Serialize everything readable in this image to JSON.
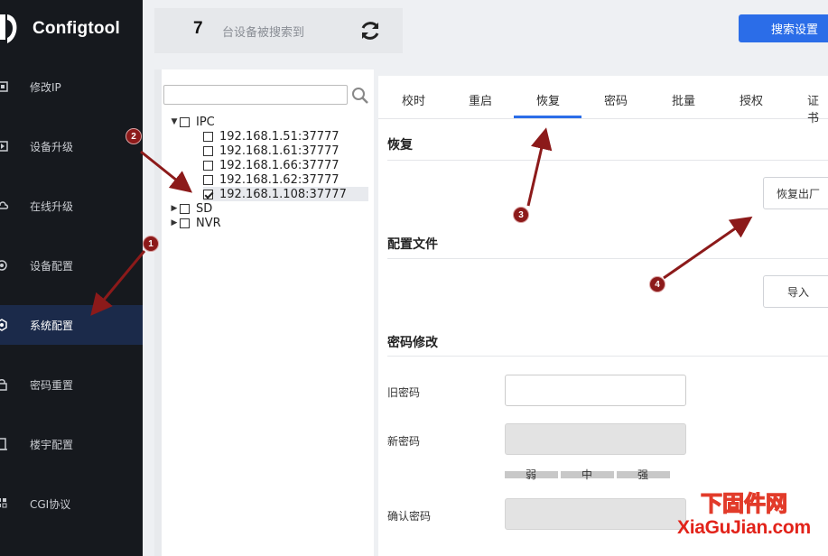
{
  "app": {
    "title": "Configtool"
  },
  "sidebar": {
    "items": [
      {
        "label": "修改IP",
        "icon": "modify-ip-icon"
      },
      {
        "label": "设备升级",
        "icon": "device-upgrade-icon"
      },
      {
        "label": "在线升级",
        "icon": "online-upgrade-icon"
      },
      {
        "label": "设备配置",
        "icon": "device-config-icon"
      },
      {
        "label": "系统配置",
        "icon": "system-config-icon",
        "active": true
      },
      {
        "label": "密码重置",
        "icon": "password-reset-icon"
      },
      {
        "label": "楼宇配置",
        "icon": "building-config-icon"
      },
      {
        "label": "CGI协议",
        "icon": "cgi-protocol-icon"
      }
    ]
  },
  "topbar": {
    "device_count": "7",
    "device_text": "台设备被搜索到",
    "search_settings_label": "搜索设置"
  },
  "tree": {
    "search_placeholder": "",
    "groups": [
      {
        "label": "IPC",
        "expanded": true,
        "checked": false
      },
      {
        "label": "SD",
        "expanded": false,
        "checked": false
      },
      {
        "label": "NVR",
        "expanded": false,
        "checked": false
      }
    ],
    "devices": [
      {
        "label": "192.168.1.51:37777",
        "checked": false
      },
      {
        "label": "192.168.1.61:37777",
        "checked": false
      },
      {
        "label": "192.168.1.66:37777",
        "checked": false
      },
      {
        "label": "192.168.1.62:37777",
        "checked": false
      },
      {
        "label": "192.168.1.108:37777",
        "checked": true
      }
    ]
  },
  "tabs": [
    {
      "label": "校时"
    },
    {
      "label": "重启"
    },
    {
      "label": "恢复",
      "active": true
    },
    {
      "label": "密码"
    },
    {
      "label": "批量"
    },
    {
      "label": "授权"
    },
    {
      "label": "证书"
    }
  ],
  "restore": {
    "title": "恢复",
    "factory_button": "恢复出厂"
  },
  "config_file": {
    "title": "配置文件",
    "import_button": "导入"
  },
  "password": {
    "title": "密码修改",
    "old_label": "旧密码",
    "new_label": "新密码",
    "confirm_label": "确认密码",
    "strength": [
      "弱",
      "中",
      "强"
    ]
  },
  "annotations": [
    "1",
    "2",
    "3",
    "4"
  ],
  "colors": {
    "accent": "#2b6de8",
    "sidebar_bg": "#16191e",
    "annotation": "#8c1a1a"
  },
  "watermark": {
    "cn": "下固件网",
    "en": "XiaGuJian.com"
  }
}
